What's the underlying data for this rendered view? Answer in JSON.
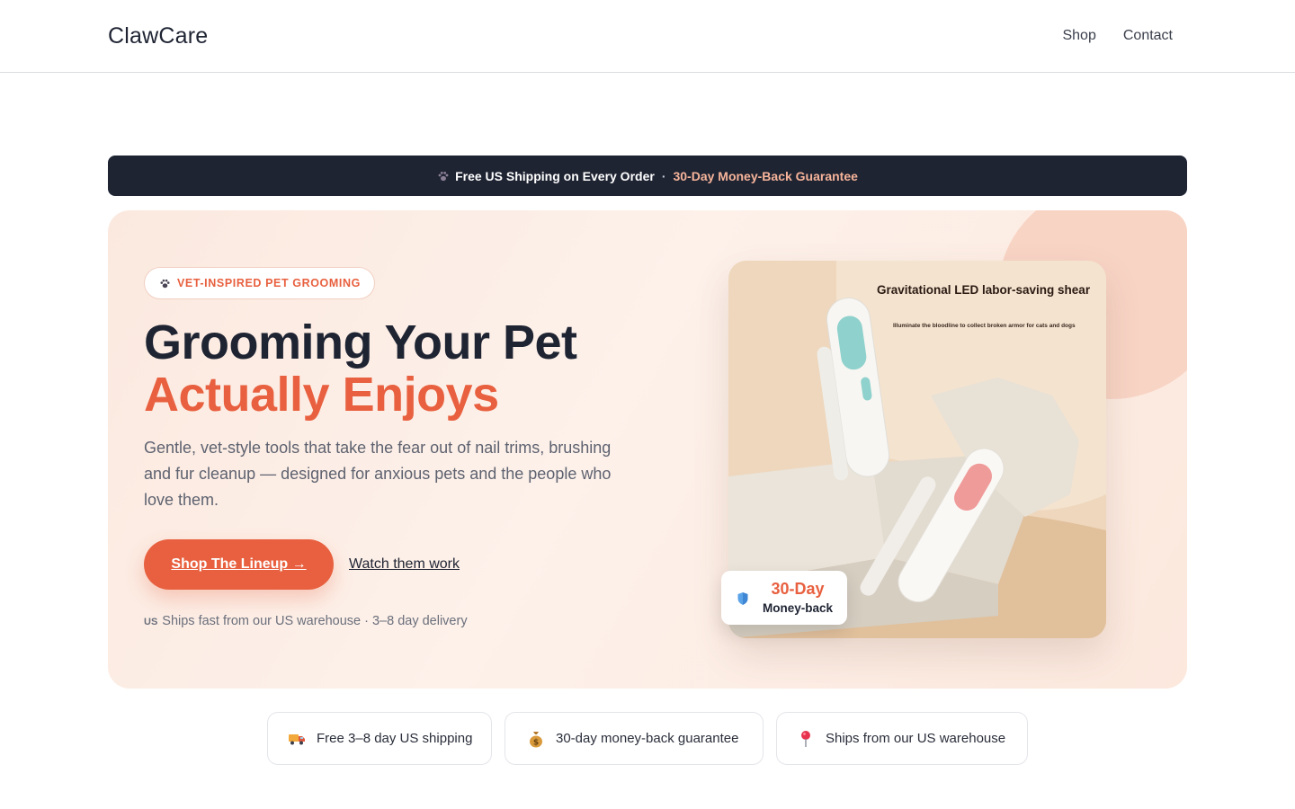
{
  "header": {
    "brand": "ClawCare",
    "nav": [
      {
        "label": "Shop"
      },
      {
        "label": "Contact"
      }
    ]
  },
  "announcement": {
    "shipping": "Free US Shipping on Every Order",
    "separator": "·",
    "guarantee": "30-Day Money-Back Guarantee",
    "icon": "paw-icon"
  },
  "hero": {
    "eyebrow": "VET-INSPIRED PET GROOMING",
    "headline_line1": "Grooming Your Pet",
    "headline_line2": "Actually Enjoys",
    "subcopy": "Gentle, vet-style tools that take the fear out of nail trims, brushing and fur cleanup — designed for anxious pets and the people who love them.",
    "cta_label": "Shop The Lineup →",
    "secondary_link": "Watch them work",
    "ship_flag": "US",
    "ship_note": "Ships fast from our US warehouse · 3–8 day delivery",
    "product_image": {
      "title": "Gravitational LED labor-saving shear",
      "subtitle": "Illuminate the bloodline to collect broken armor for cats and dogs"
    },
    "badge": {
      "line1": "30-Day",
      "line2": "Money-back",
      "icon": "shield-icon"
    }
  },
  "trust_badges": [
    {
      "icon": "truck-icon",
      "label": "Free 3–8 day US shipping"
    },
    {
      "icon": "money-bag-icon",
      "label": "30-day money-back guarantee"
    },
    {
      "icon": "pin-icon",
      "label": "Ships from our US warehouse"
    }
  ],
  "colors": {
    "accent": "#e8603f",
    "dark": "#1f2433",
    "hero_bg": "#fbe9df"
  }
}
